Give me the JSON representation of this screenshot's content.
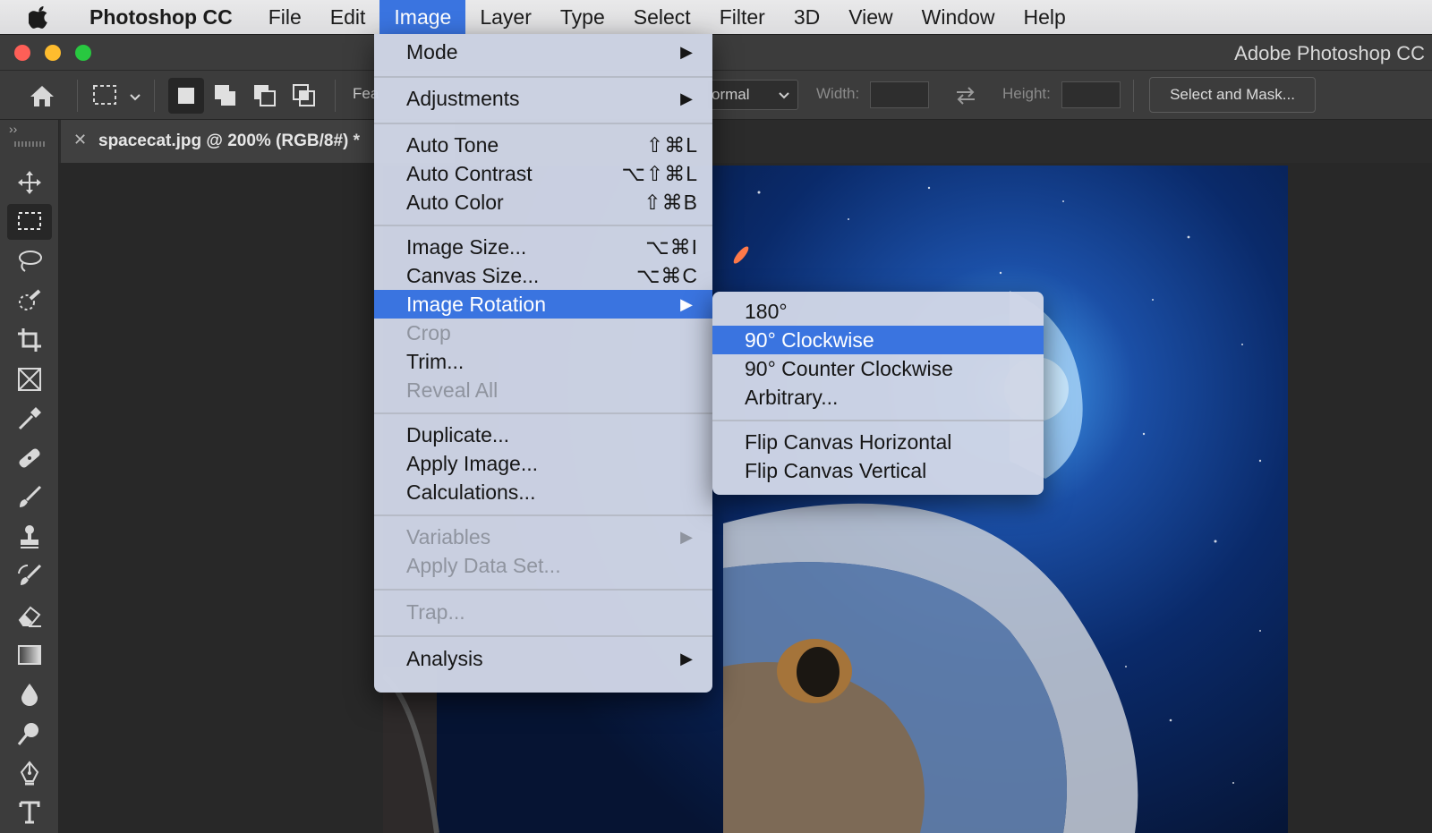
{
  "menubar": {
    "app_name": "Photoshop CC",
    "items": [
      "File",
      "Edit",
      "Image",
      "Layer",
      "Type",
      "Select",
      "Filter",
      "3D",
      "View",
      "Window",
      "Help"
    ],
    "active": "Image"
  },
  "window": {
    "title": "Adobe Photoshop CC"
  },
  "options_bar": {
    "feather_label": "Fea",
    "style_value": "ormal",
    "width_label": "Width:",
    "height_label": "Height:",
    "select_mask_label": "Select and Mask..."
  },
  "document_tab": {
    "close": "✕",
    "name": "spacecat.jpg @ 200% (RGB/8#) *"
  },
  "tools_panel": {
    "collapse": "››"
  },
  "image_menu": {
    "items": [
      {
        "label": "Mode",
        "submenu": true
      },
      {
        "label": "Adjustments",
        "submenu": true
      },
      {
        "label": "Auto Tone",
        "shortcut": "⇧⌘L"
      },
      {
        "label": "Auto Contrast",
        "shortcut": "⌥⇧⌘L"
      },
      {
        "label": "Auto Color",
        "shortcut": "⇧⌘B"
      },
      {
        "label": "Image Size...",
        "shortcut": "⌥⌘I"
      },
      {
        "label": "Canvas Size...",
        "shortcut": "⌥⌘C"
      },
      {
        "label": "Image Rotation",
        "submenu": true,
        "highlighted": true
      },
      {
        "label": "Crop",
        "disabled": true
      },
      {
        "label": "Trim..."
      },
      {
        "label": "Reveal All",
        "disabled": true
      },
      {
        "label": "Duplicate..."
      },
      {
        "label": "Apply Image..."
      },
      {
        "label": "Calculations..."
      },
      {
        "label": "Variables",
        "submenu": true,
        "disabled": true
      },
      {
        "label": "Apply Data Set...",
        "disabled": true
      },
      {
        "label": "Trap...",
        "disabled": true
      },
      {
        "label": "Analysis",
        "submenu": true
      }
    ],
    "arrow": "▶"
  },
  "rotation_menu": {
    "items": [
      {
        "label": "180°"
      },
      {
        "label": "90° Clockwise",
        "highlighted": true
      },
      {
        "label": "90° Counter Clockwise"
      },
      {
        "label": "Arbitrary..."
      },
      {
        "label": "Flip Canvas Horizontal"
      },
      {
        "label": "Flip Canvas Vertical"
      }
    ]
  },
  "colors": {
    "highlight": "#3a74e0",
    "menu_bg": "#d0d6e6",
    "app_bg": "#3c3c3c"
  },
  "icons": [
    "apple-icon",
    "home-icon",
    "marquee-icon",
    "move-icon",
    "lasso-icon",
    "crop-icon",
    "eyedropper-icon",
    "brush-icon",
    "eraser-icon",
    "pen-icon",
    "type-icon"
  ]
}
